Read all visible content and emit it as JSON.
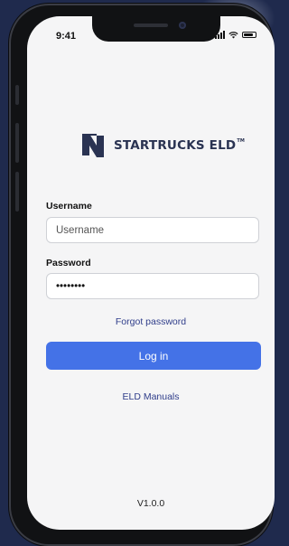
{
  "status_bar": {
    "time": "9:41"
  },
  "brand": {
    "name": "STARTRUCKS ELD",
    "trademark": "TM"
  },
  "form": {
    "username": {
      "label": "Username",
      "placeholder": "Username",
      "value": ""
    },
    "password": {
      "label": "Password",
      "value": "••••••••"
    }
  },
  "links": {
    "forgot_password": "Forgot password",
    "eld_manuals": "ELD Manuals"
  },
  "login_button": {
    "label": "Log in"
  },
  "footer": {
    "version": "V1.0.0"
  },
  "colors": {
    "brand": "#2a3352",
    "primary": "#4472e7",
    "link": "#2f3d8a",
    "background": "#1f2a4d"
  }
}
